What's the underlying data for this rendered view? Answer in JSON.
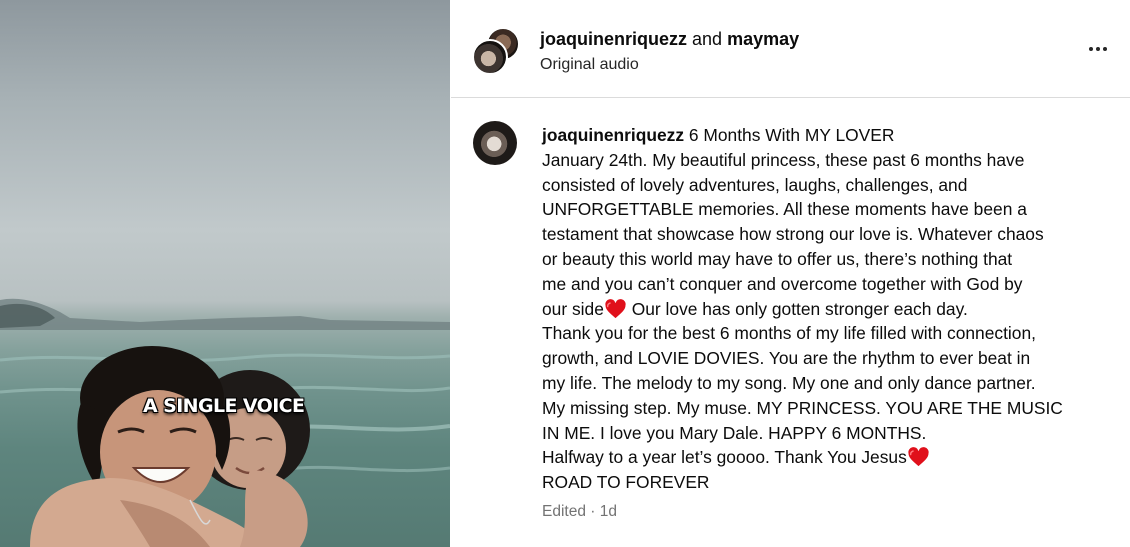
{
  "media": {
    "overlay_text": "A SINGLE VOICE"
  },
  "header": {
    "author": "joaquinenriquezz",
    "connector": "and",
    "coauthor": "maymay",
    "audio": "Original audio",
    "more_icon": "more-horizontal-icon"
  },
  "comment": {
    "username": "joaquinenriquezz",
    "lines": [
      "6 Months With MY LOVER",
      "January 24th. My beautiful princess, these past 6 months have",
      "consisted of lovely adventures, laughs, challenges, and",
      "UNFORGETTABLE memories. All these moments have been a",
      "testament that showcase how strong our love is. Whatever chaos",
      "or beauty this world may have to offer us, there’s nothing that",
      "me and you can’t conquer and overcome together with God by",
      "our side",
      "Our love has only gotten stronger each day.",
      "Thank you for the best 6 months of my life filled with connection,",
      "growth, and LOVIE DOVIES. You are the rhythm to ever beat in",
      "my life. The melody to my song. My one and only dance partner.",
      "My missing step. My muse. MY PRINCESS. YOU ARE THE MUSIC",
      "IN ME. I love you Mary Dale. HAPPY 6 MONTHS.",
      "Halfway to a year let’s goooo. Thank You Jesus",
      "ROAD TO FOREVER"
    ],
    "emoji": "heart-emoji",
    "heart_color": "#e0101b",
    "meta": "Edited · 1d"
  },
  "colors": {
    "text_primary": "#0c0c0c",
    "text_secondary": "#737373",
    "divider": "#dbdbdb"
  }
}
